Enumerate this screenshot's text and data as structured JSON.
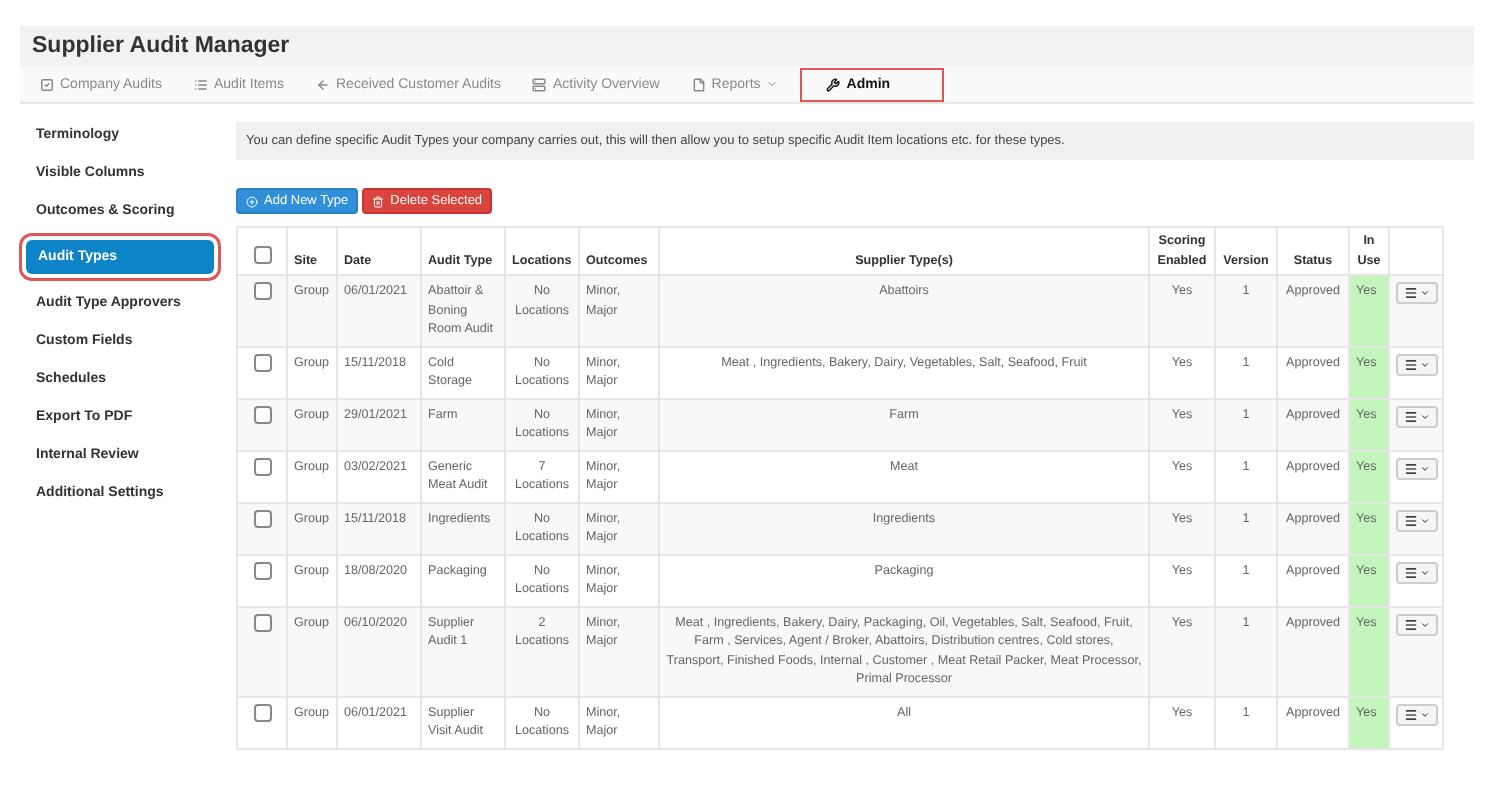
{
  "app_title": "Supplier Audit Manager",
  "nav": [
    {
      "label": "Company Audits",
      "selected": false,
      "highlighted": false,
      "dropdown": false
    },
    {
      "label": "Audit Items",
      "selected": false,
      "highlighted": false,
      "dropdown": false
    },
    {
      "label": "Received Customer Audits",
      "selected": false,
      "highlighted": false,
      "dropdown": false
    },
    {
      "label": "Activity Overview",
      "selected": false,
      "highlighted": false,
      "dropdown": false
    },
    {
      "label": "Reports",
      "selected": false,
      "highlighted": false,
      "dropdown": true
    },
    {
      "label": "Admin",
      "selected": true,
      "highlighted": true,
      "dropdown": false
    }
  ],
  "sidebar": {
    "items": [
      {
        "label": "Terminology",
        "selected": false,
        "highlighted": false
      },
      {
        "label": "Visible Columns",
        "selected": false,
        "highlighted": false
      },
      {
        "label": "Outcomes & Scoring",
        "selected": false,
        "highlighted": false
      },
      {
        "label": "Audit Types",
        "selected": true,
        "highlighted": true
      },
      {
        "label": "Audit Type Approvers",
        "selected": false,
        "highlighted": false
      },
      {
        "label": "Custom Fields",
        "selected": false,
        "highlighted": false
      },
      {
        "label": "Schedules",
        "selected": false,
        "highlighted": false
      },
      {
        "label": "Export To PDF",
        "selected": false,
        "highlighted": false
      },
      {
        "label": "Internal Review",
        "selected": false,
        "highlighted": false
      },
      {
        "label": "Additional Settings",
        "selected": false,
        "highlighted": false
      }
    ]
  },
  "info": "You can define specific Audit Types your company carries out, this will then allow you to setup specific Audit Item locations etc. for these types.",
  "buttons": [
    {
      "label": "Add New Type",
      "kind": "primary"
    },
    {
      "label": "Delete Selected",
      "kind": "danger"
    }
  ],
  "table": {
    "select_all_checked": false,
    "columns": [
      "Site",
      "Date",
      "Audit Type",
      "Locations",
      "Outcomes",
      "Supplier Type(s)",
      "Scoring Enabled",
      "Version",
      "Status",
      "In Use"
    ],
    "rows": [
      {
        "checked": false,
        "cells": [
          "Group",
          "06/01/2021",
          "Abattoir & Boning Room Audit",
          "No Locations",
          "Minor, Major",
          "Abattoirs",
          "Yes",
          "1",
          "Approved",
          "Yes"
        ]
      },
      {
        "checked": false,
        "cells": [
          "Group",
          "15/11/2018",
          "Cold Storage",
          "No Locations",
          "Minor, Major",
          "Meat , Ingredients, Bakery, Dairy, Vegetables, Salt, Seafood, Fruit",
          "Yes",
          "1",
          "Approved",
          "Yes"
        ]
      },
      {
        "checked": false,
        "cells": [
          "Group",
          "29/01/2021",
          "Farm",
          "No Locations",
          "Minor, Major",
          "Farm",
          "Yes",
          "1",
          "Approved",
          "Yes"
        ]
      },
      {
        "checked": false,
        "cells": [
          "Group",
          "03/02/2021",
          "Generic Meat Audit",
          "7 Locations",
          "Minor, Major",
          "Meat",
          "Yes",
          "1",
          "Approved",
          "Yes"
        ]
      },
      {
        "checked": false,
        "cells": [
          "Group",
          "15/11/2018",
          "Ingredients",
          "No Locations",
          "Minor, Major",
          "Ingredients",
          "Yes",
          "1",
          "Approved",
          "Yes"
        ]
      },
      {
        "checked": false,
        "cells": [
          "Group",
          "18/08/2020",
          "Packaging",
          "No Locations",
          "Minor, Major",
          "Packaging",
          "Yes",
          "1",
          "Approved",
          "Yes"
        ]
      },
      {
        "checked": false,
        "cells": [
          "Group",
          "06/10/2020",
          "Supplier Audit 1",
          "2 Locations",
          "Minor, Major",
          "Meat , Ingredients, Bakery, Dairy, Packaging, Oil, Vegetables, Salt, Seafood, Fruit, Farm , Services, Agent / Broker, Abattoirs, Distribution centres, Cold stores, Transport, Finished Foods, Internal , Customer , Meat Retail Packer, Meat Processor, Primal Processor",
          "Yes",
          "1",
          "Approved",
          "Yes"
        ]
      },
      {
        "checked": false,
        "cells": [
          "Group",
          "06/01/2021",
          "Supplier Visit Audit",
          "No Locations",
          "Minor, Major",
          "All",
          "Yes",
          "1",
          "Approved",
          "Yes"
        ]
      }
    ]
  }
}
